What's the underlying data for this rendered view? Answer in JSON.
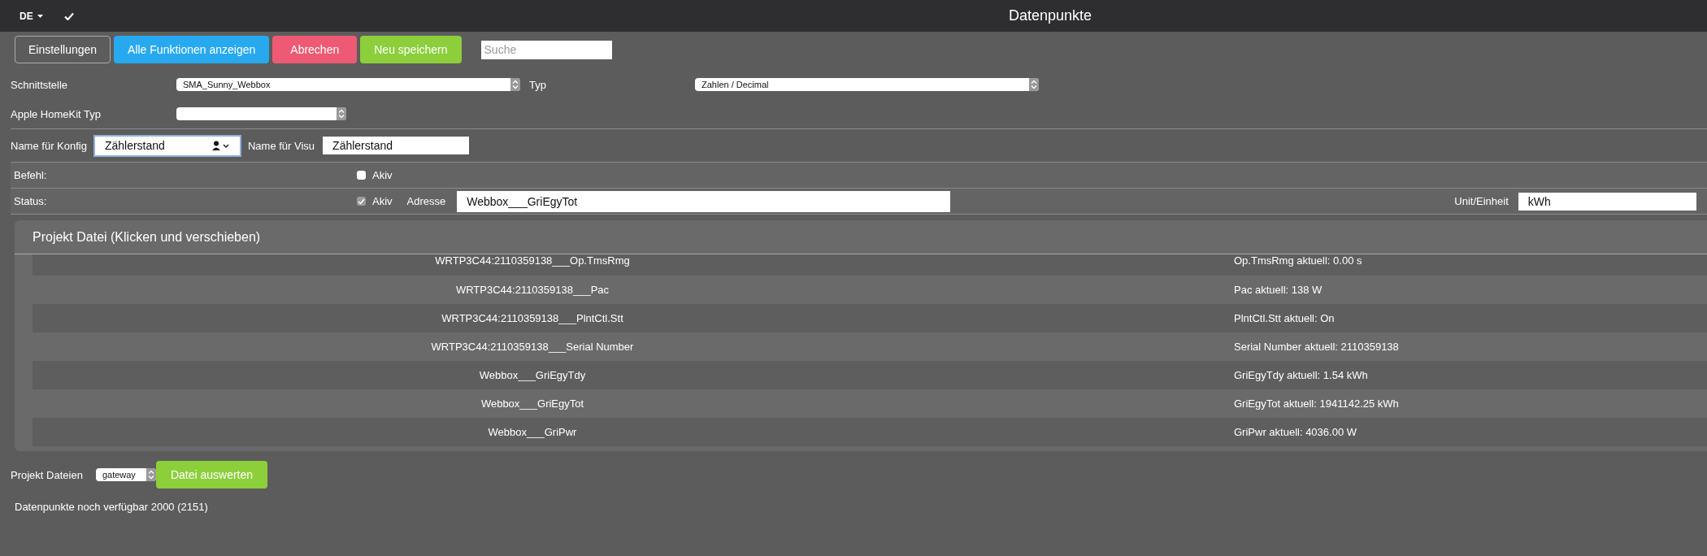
{
  "top_bar": {
    "language": "DE",
    "title": "Datenpunkte"
  },
  "toolbar": {
    "buttons": [
      {
        "label": "Einstellungen",
        "kind": "outline"
      },
      {
        "label": "Alle Funktionen anzeigen",
        "kind": "info"
      },
      {
        "label": "Abrechen",
        "kind": "danger"
      },
      {
        "label": "Neu speichern",
        "kind": "success"
      }
    ],
    "search": {
      "placeholder": "Suche"
    }
  },
  "settings": {
    "interface": {
      "label": "Schnittstelle",
      "value": "SMA_Sunny_Webbox"
    },
    "type": {
      "label": "Typ",
      "value": "Zahlen / Decimal"
    },
    "homekit": {
      "label": "Apple HomeKit Typ"
    }
  },
  "names": {
    "config": {
      "label": "Name für Konfig",
      "value": "Zählerstand"
    },
    "visu": {
      "label": "Name für Visu",
      "value": "Zählerstand"
    }
  },
  "command": {
    "label": "Befehl:",
    "active_label": "Akiv",
    "checked": false
  },
  "status": {
    "label": "Status:",
    "active_label": "Akiv",
    "checked": true,
    "address_label": "Adresse",
    "address": "Webbox___GriEgyTot",
    "unit_label": "Unit/Einheit",
    "unit": "kWh"
  },
  "project_file": {
    "title": "Projekt Datei (Klicken und verschieben)",
    "rows": [
      {
        "name": "WRTP3C44:2110359138___Op.TmsRmg",
        "current": "Op.TmsRmg aktuell: 0.00 s"
      },
      {
        "name": "WRTP3C44:2110359138___Pac",
        "current": "Pac aktuell: 138 W"
      },
      {
        "name": "WRTP3C44:2110359138___PlntCtl.Stt",
        "current": "PlntCtl.Stt aktuell: On"
      },
      {
        "name": "WRTP3C44:2110359138___Serial Number",
        "current": "Serial Number aktuell: 2110359138"
      },
      {
        "name": "Webbox___GriEgyTdy",
        "current": "GriEgyTdy aktuell: 1.54 kWh"
      },
      {
        "name": "Webbox___GriEgyTot",
        "current": "GriEgyTot aktuell: 1941142.25 kWh"
      },
      {
        "name": "Webbox___GriPwr",
        "current": "GriPwr aktuell: 4036.00 W"
      }
    ]
  },
  "project_files": {
    "label": "Projekt Dateien",
    "value": "gateway",
    "button": "Datei auswerten"
  },
  "footer": "Datenpunkte noch verfügbar 2000 (2151)"
}
